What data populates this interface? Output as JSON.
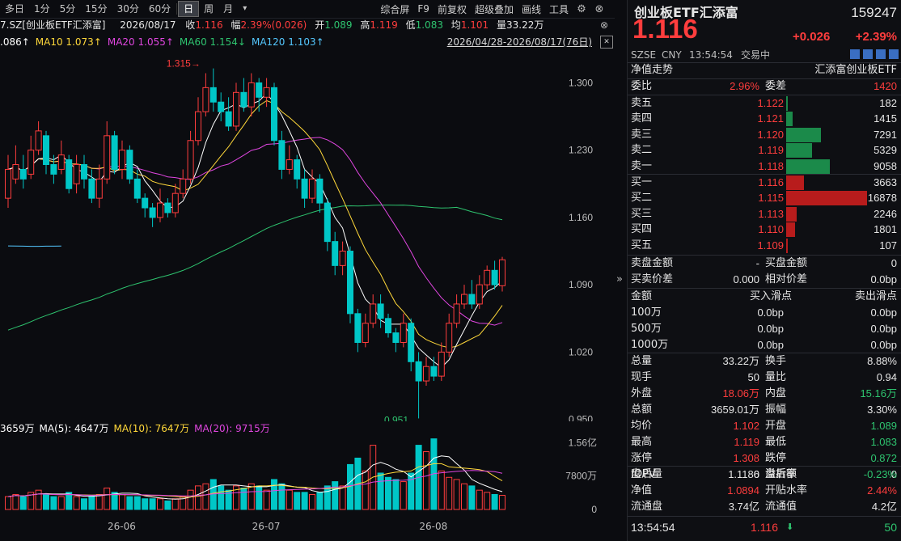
{
  "toolbar": {
    "timeframes": [
      "多日",
      "1分",
      "5分",
      "15分",
      "30分",
      "60分",
      "日",
      "周",
      "月"
    ],
    "active": "日",
    "tools": [
      "综合屏",
      "F9",
      "前复权",
      "超级叠加",
      "画线",
      "工具"
    ]
  },
  "info": {
    "code_name": "7.SZ[创业板ETF汇添富]",
    "date": "2026/08/17",
    "close_label": "收",
    "close": "1.116",
    "change_label": "幅",
    "change": "2.39%(0.026)",
    "open_label": "开",
    "open": "1.089",
    "high_label": "高",
    "high": "1.119",
    "low_label": "低",
    "low": "1.083",
    "avg_label": "均",
    "avg": "1.101",
    "vol_label": "量",
    "vol": "33.22万"
  },
  "ma": [
    {
      "text": ".086↑",
      "color": "#ffffff"
    },
    {
      "text": "MA10 1.073↑",
      "color": "#ffd83a"
    },
    {
      "text": "MA20 1.055↑",
      "color": "#e046e0"
    },
    {
      "text": "MA60 1.154↓",
      "color": "#2ec46f"
    },
    {
      "text": "MA120 1.103↑",
      "color": "#54c8ff"
    }
  ],
  "range": "2026/04/28-2026/08/17(76日)",
  "vol_ma": [
    {
      "text": "3659万",
      "color": "#ffffff"
    },
    {
      "text": "MA(5): 4647万",
      "color": "#ffffff"
    },
    {
      "text": "MA(10): 7647万",
      "color": "#ffd83a"
    },
    {
      "text": "MA(20): 9715万",
      "color": "#e046e0"
    }
  ],
  "chart_data": {
    "type": "candlestick",
    "price_axis": {
      "ticks": [
        "1.300",
        "1.230",
        "1.160",
        "1.090",
        "1.020",
        "0.950"
      ],
      "values": [
        1.3,
        1.23,
        1.16,
        1.09,
        1.02,
        0.95
      ],
      "ylim": [
        0.948,
        1.334
      ]
    },
    "vol_axis": {
      "ticks": [
        "1.56亿",
        "7800万",
        "0"
      ],
      "values": [
        1.56,
        0.78,
        0
      ],
      "ylim": [
        0,
        1.7
      ],
      "unit": "亿"
    },
    "x_labels": [
      {
        "label": "26-06",
        "index": 15
      },
      {
        "label": "26-07",
        "index": 34
      },
      {
        "label": "26-08",
        "index": 56
      }
    ],
    "annotations": [
      {
        "text": "1.315",
        "index": 27,
        "price": 1.315,
        "dir": "right"
      },
      {
        "text": "0.951",
        "index": 55,
        "price": 0.951,
        "dir": "left"
      }
    ],
    "colors": {
      "up": "#ff3d3d",
      "down": "#00c7c7",
      "ma5": "#ffffff",
      "ma10": "#ffd83a",
      "ma20": "#e046e0",
      "ma60": "#2ec46f",
      "ma120": "#54c8ff"
    },
    "candles": [
      [
        1.18,
        1.21,
        1.225,
        1.17,
        0.3
      ],
      [
        1.2,
        1.215,
        1.235,
        1.195,
        0.35
      ],
      [
        1.21,
        1.2,
        1.225,
        1.19,
        0.3
      ],
      [
        1.205,
        1.23,
        1.245,
        1.2,
        0.4
      ],
      [
        1.23,
        1.25,
        1.26,
        1.225,
        0.45
      ],
      [
        1.245,
        1.215,
        1.25,
        1.205,
        0.35
      ],
      [
        1.215,
        1.205,
        1.225,
        1.195,
        0.3
      ],
      [
        1.21,
        1.225,
        1.24,
        1.205,
        0.3
      ],
      [
        1.22,
        1.19,
        1.225,
        1.185,
        0.4
      ],
      [
        1.195,
        1.215,
        1.225,
        1.185,
        0.3
      ],
      [
        1.215,
        1.2,
        1.225,
        1.19,
        0.25
      ],
      [
        1.2,
        1.18,
        1.21,
        1.175,
        0.3
      ],
      [
        1.18,
        1.2,
        1.215,
        1.17,
        0.35
      ],
      [
        1.2,
        1.245,
        1.26,
        1.195,
        0.5
      ],
      [
        1.245,
        1.21,
        1.25,
        1.205,
        0.4
      ],
      [
        1.21,
        1.23,
        1.24,
        1.2,
        0.35
      ],
      [
        1.23,
        1.2,
        1.235,
        1.195,
        0.3
      ],
      [
        1.2,
        1.18,
        1.21,
        1.175,
        0.3
      ],
      [
        1.18,
        1.17,
        1.185,
        1.16,
        0.25
      ],
      [
        1.17,
        1.16,
        1.175,
        1.15,
        0.25
      ],
      [
        1.16,
        1.175,
        1.19,
        1.155,
        0.25
      ],
      [
        1.175,
        1.165,
        1.18,
        1.16,
        0.2
      ],
      [
        1.165,
        1.185,
        1.195,
        1.16,
        0.25
      ],
      [
        1.185,
        1.2,
        1.21,
        1.18,
        0.3
      ],
      [
        1.2,
        1.24,
        1.25,
        1.195,
        0.45
      ],
      [
        1.24,
        1.27,
        1.285,
        1.235,
        0.55
      ],
      [
        1.27,
        1.295,
        1.31,
        1.265,
        0.6
      ],
      [
        1.295,
        1.28,
        1.315,
        1.27,
        0.7
      ],
      [
        1.28,
        1.27,
        1.29,
        1.26,
        0.55
      ],
      [
        1.27,
        1.255,
        1.285,
        1.25,
        0.45
      ],
      [
        1.255,
        1.29,
        1.3,
        1.25,
        0.55
      ],
      [
        1.29,
        1.275,
        1.305,
        1.27,
        0.5
      ],
      [
        1.275,
        1.3,
        1.31,
        1.265,
        0.6
      ],
      [
        1.3,
        1.285,
        1.305,
        1.27,
        0.55
      ],
      [
        1.285,
        1.295,
        1.305,
        1.275,
        0.45
      ],
      [
        1.295,
        1.24,
        1.3,
        1.235,
        0.7
      ],
      [
        1.24,
        1.21,
        1.25,
        1.2,
        0.6
      ],
      [
        1.21,
        1.22,
        1.235,
        1.205,
        0.45
      ],
      [
        1.22,
        1.2,
        1.225,
        1.19,
        0.4
      ],
      [
        1.2,
        1.18,
        1.21,
        1.17,
        0.4
      ],
      [
        1.18,
        1.2,
        1.21,
        1.175,
        0.35
      ],
      [
        1.2,
        1.175,
        1.205,
        1.165,
        0.4
      ],
      [
        1.175,
        1.135,
        1.18,
        1.125,
        0.55
      ],
      [
        1.135,
        1.11,
        1.145,
        1.1,
        0.65
      ],
      [
        1.11,
        1.125,
        1.135,
        1.1,
        0.55
      ],
      [
        1.125,
        1.06,
        1.13,
        1.05,
        1.05
      ],
      [
        1.06,
        1.03,
        1.065,
        1.02,
        1.2
      ],
      [
        1.03,
        1.05,
        1.06,
        1.025,
        0.9
      ],
      [
        1.05,
        1.07,
        1.08,
        1.045,
        1.5
      ],
      [
        1.07,
        1.055,
        1.08,
        1.045,
        0.85
      ],
      [
        1.055,
        1.04,
        1.06,
        1.035,
        0.75
      ],
      [
        1.04,
        1.03,
        1.045,
        1.02,
        0.7
      ],
      [
        1.03,
        1.05,
        1.06,
        1.025,
        0.65
      ],
      [
        1.05,
        1.01,
        1.055,
        1.0,
        0.85
      ],
      [
        1.01,
        0.99,
        1.02,
        0.951,
        1.5
      ],
      [
        0.99,
        1.005,
        1.015,
        0.985,
        1.35
      ],
      [
        1.005,
        0.995,
        1.015,
        0.99,
        1.65
      ],
      [
        0.995,
        1.02,
        1.03,
        0.99,
        0.9
      ],
      [
        1.02,
        1.05,
        1.06,
        1.015,
        0.75
      ],
      [
        1.05,
        1.07,
        1.08,
        1.045,
        0.7
      ],
      [
        1.07,
        1.08,
        1.09,
        1.065,
        0.6
      ],
      [
        1.08,
        1.07,
        1.095,
        1.065,
        0.55
      ],
      [
        1.07,
        1.09,
        1.1,
        1.065,
        0.45
      ],
      [
        1.09,
        1.105,
        1.11,
        1.085,
        0.4
      ],
      [
        1.105,
        1.09,
        1.115,
        1.085,
        0.35
      ],
      [
        1.089,
        1.116,
        1.119,
        1.083,
        0.33
      ]
    ]
  },
  "quote": {
    "name": "创业板ETF汇添富",
    "code": "159247",
    "price": "1.116",
    "change": "+0.026",
    "change_pct": "+2.39%",
    "market": "SZSE",
    "currency": "CNY",
    "time": "13:54:54",
    "status": "交易中",
    "nav_trend": "净值走势",
    "fund_name": "汇添富创业板ETF",
    "weibi_label": "委比",
    "weibi": "2.96%",
    "weicha_label": "委差",
    "weicha": "1420",
    "asks": [
      {
        "label": "卖五",
        "price": "1.122",
        "vol": "182",
        "qty": 182
      },
      {
        "label": "卖四",
        "price": "1.121",
        "vol": "1415",
        "qty": 1415
      },
      {
        "label": "卖三",
        "price": "1.120",
        "vol": "7291",
        "qty": 7291
      },
      {
        "label": "卖二",
        "price": "1.119",
        "vol": "5329",
        "qty": 5329
      },
      {
        "label": "卖一",
        "price": "1.118",
        "vol": "9058",
        "qty": 9058
      }
    ],
    "bids": [
      {
        "label": "买一",
        "price": "1.116",
        "vol": "3663",
        "qty": 3663
      },
      {
        "label": "买二",
        "price": "1.115",
        "vol": "16878",
        "qty": 16878
      },
      {
        "label": "买三",
        "price": "1.113",
        "vol": "2246",
        "qty": 2246
      },
      {
        "label": "买四",
        "price": "1.110",
        "vol": "1801",
        "qty": 1801
      },
      {
        "label": "买五",
        "price": "1.109",
        "vol": "107",
        "qty": 107
      }
    ],
    "amounts": [
      {
        "l1": "卖盘金额",
        "v1": "-",
        "l2": "买盘金额",
        "v2": "0"
      },
      {
        "l1": "买卖价差",
        "v1": "0.000",
        "l2": "相对价差",
        "v2": "0.0bp"
      }
    ],
    "slip_head": {
      "l1": "金额",
      "l2": "买入滑点",
      "l3": "卖出滑点"
    },
    "slip": [
      {
        "l": "100万",
        "a": "0.0bp",
        "b": "0.0bp"
      },
      {
        "l": "500万",
        "a": "0.0bp",
        "b": "0.0bp"
      },
      {
        "l": "1000万",
        "a": "0.0bp",
        "b": "0.0bp"
      }
    ],
    "stats": [
      {
        "l1": "总量",
        "v1": "33.22万",
        "c1": "white",
        "l2": "换手",
        "v2": "8.88%",
        "c2": "white"
      },
      {
        "l1": "现手",
        "v1": "50",
        "c1": "white",
        "l2": "量比",
        "v2": "0.94",
        "c2": "white"
      },
      {
        "l1": "外盘",
        "v1": "18.06万",
        "c1": "red",
        "l2": "内盘",
        "v2": "15.16万",
        "c2": "green"
      },
      {
        "l1": "总额",
        "v1": "3659.01万",
        "c1": "white",
        "l2": "振幅",
        "v2": "3.30%",
        "c2": "white"
      },
      {
        "l1": "均价",
        "v1": "1.102",
        "c1": "red",
        "l2": "开盘",
        "v2": "1.089",
        "c2": "green"
      },
      {
        "l1": "最高",
        "v1": "1.119",
        "c1": "red",
        "l2": "最低",
        "v2": "1.083",
        "c2": "green"
      },
      {
        "l1": "涨停",
        "v1": "1.308",
        "c1": "red",
        "l2": "跌停",
        "v2": "0.872",
        "c2": "green"
      },
      {
        "l1": "盘后量",
        "v1": "0",
        "c1": "white",
        "l2": "盘后额",
        "v2": "0",
        "c2": "white"
      }
    ],
    "iopv": [
      {
        "l1": "IOPV",
        "v1": "1.1186",
        "c1": "white",
        "l2": "溢折率",
        "v2": "-0.23%",
        "c2": "green"
      },
      {
        "l1": "净值",
        "v1": "1.0894",
        "c1": "red",
        "l2": "开贴水率",
        "v2": "2.44%",
        "c2": "red"
      },
      {
        "l1": "流通盘",
        "v1": "3.74亿",
        "c1": "white",
        "l2": "流通值",
        "v2": "4.2亿",
        "c2": "white"
      }
    ],
    "last_tick": {
      "time": "13:54:54",
      "price": "1.116",
      "qty": "50"
    }
  }
}
